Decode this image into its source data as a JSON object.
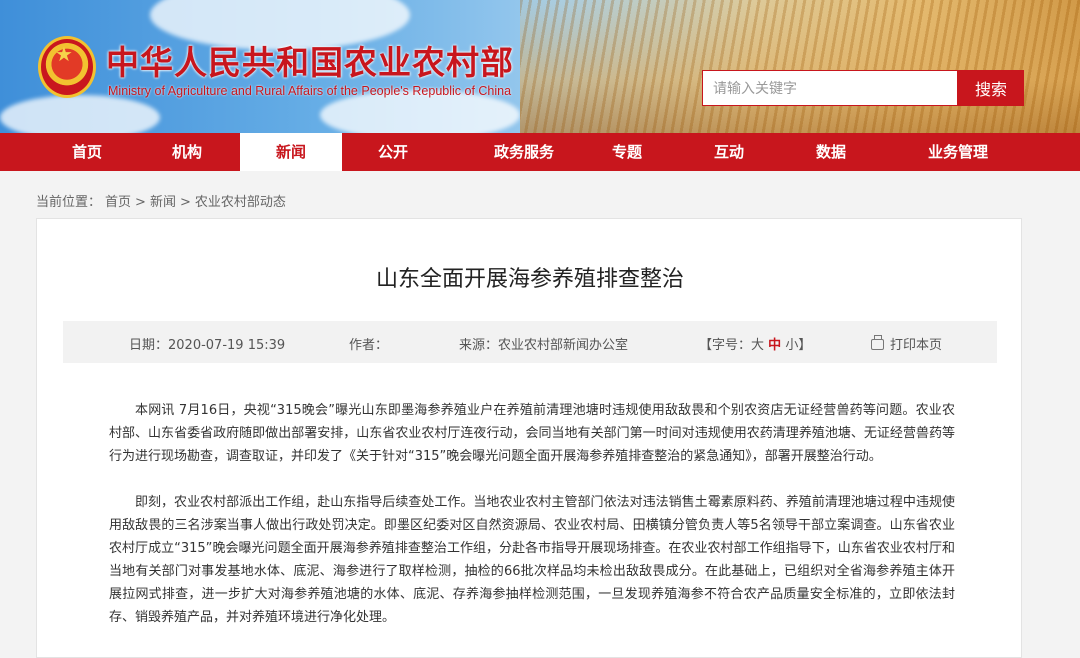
{
  "header": {
    "title": "中华人民共和国农业农村部",
    "subtitle": "Ministry of Agriculture and Rural Affairs of the People's Republic of China",
    "search_placeholder": "请输入关键字",
    "search_button": "搜索"
  },
  "nav": {
    "items": [
      "首页",
      "机构",
      "新闻",
      "公开",
      "政务服务",
      "专题",
      "互动",
      "数据",
      "业务管理"
    ],
    "active": "新闻"
  },
  "breadcrumb": {
    "prefix": "当前位置：",
    "items": [
      "首页",
      "新闻",
      "农业农村部动态"
    ],
    "separator": ">"
  },
  "article": {
    "title": "山东全面开展海参养殖排查整治",
    "date_label": "日期：",
    "date": "2020-07-19 15:39",
    "author_label": "作者：",
    "source_label": "来源：",
    "source": "农业农村部新闻办公室",
    "font_size_prefix": "【字号：",
    "font_sizes": [
      "大",
      "中",
      "小"
    ],
    "font_size_suffix": "】",
    "print_label": "打印本页",
    "paragraphs": [
      "本网讯 7月16日，央视“315晚会”曝光山东即墨海参养殖业户在养殖前清理池塘时违规使用敌敌畏和个别农资店无证经营兽药等问题。农业农村部、山东省委省政府随即做出部署安排，山东省农业农村厅连夜行动，会同当地有关部门第一时间对违规使用农药清理养殖池塘、无证经营兽药等行为进行现场勘查，调查取证，并印发了《关于针对“315”晚会曝光问题全面开展海参养殖排查整治的紧急通知》，部署开展整治行动。",
      "即刻，农业农村部派出工作组，赴山东指导后续查处工作。当地农业农村主管部门依法对违法销售土霉素原料药、养殖前清理池塘过程中违规使用敌敌畏的三名涉案当事人做出行政处罚决定。即墨区纪委对区自然资源局、农业农村局、田横镇分管负责人等5名领导干部立案调查。山东省农业农村厅成立“315”晚会曝光问题全面开展海参养殖排查整治工作组，分赴各市指导开展现场排查。在农业农村部工作组指导下，山东省农业农村厅和当地有关部门对事发基地水体、底泥、海参进行了取样检测，抽检的66批次样品均未检出敌敌畏成分。在此基础上，已组织对全省海参养殖主体开展拉网式排查，进一步扩大对海参养殖池塘的水体、底泥、存养海参抽样检测范围，一旦发现养殖海参不符合农产品质量安全标准的，立即依法封存、销毁养殖产品，并对养殖环境进行净化处理。"
    ]
  }
}
